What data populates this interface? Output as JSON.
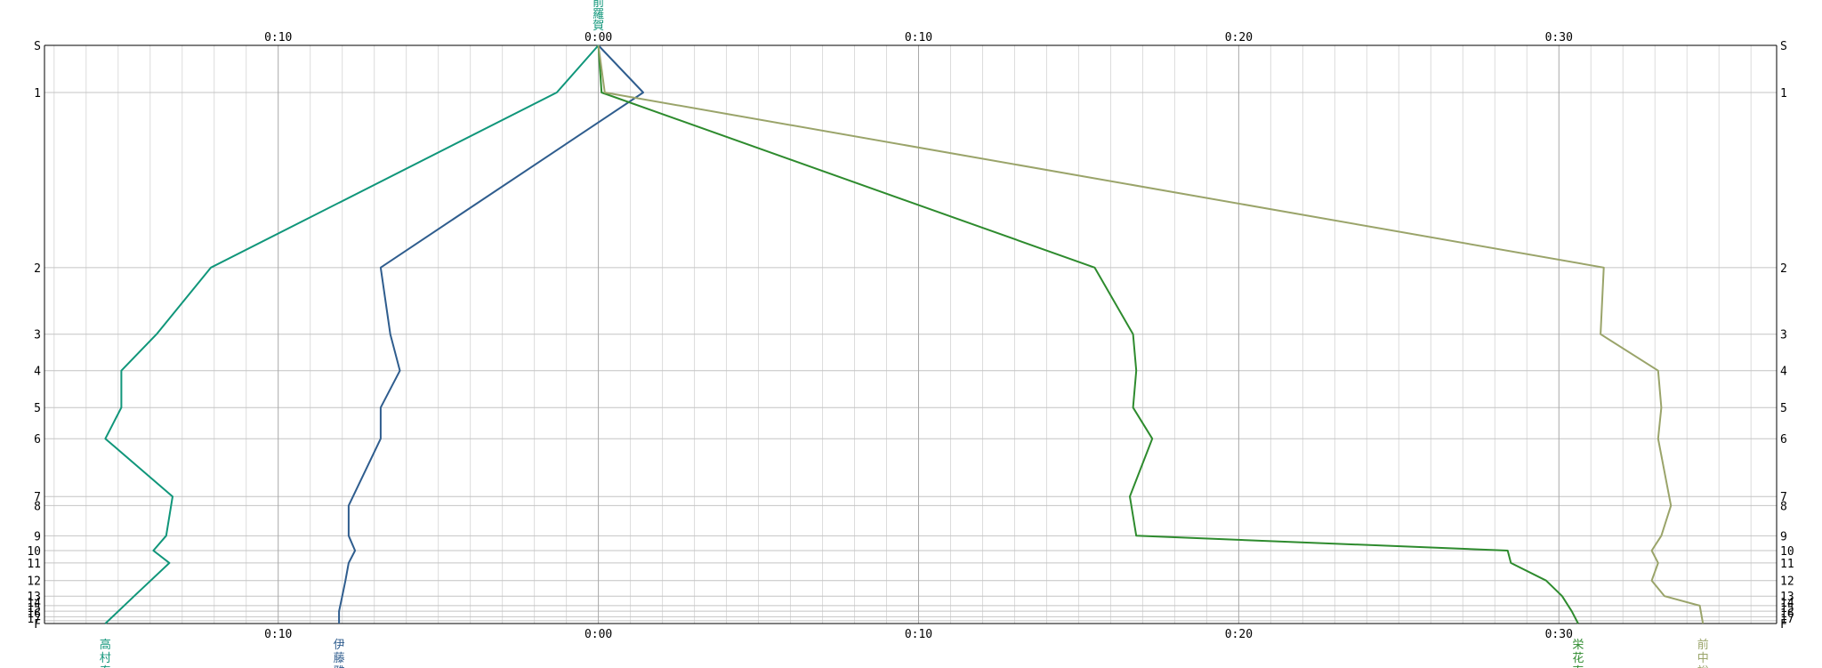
{
  "chart_data": {
    "type": "line",
    "x_unit": "minutes",
    "x_zero_origin": "0:00",
    "x_ticks": [
      {
        "value": -10,
        "label": "0:10"
      },
      {
        "value": 0,
        "label": "0:00"
      },
      {
        "value": 10,
        "label": "0:10"
      },
      {
        "value": 20,
        "label": "0:20"
      },
      {
        "value": 30,
        "label": "0:30"
      }
    ],
    "xlim": [
      -17.3,
      36.8
    ],
    "y_axis": {
      "labels": [
        "S",
        "1",
        "2",
        "3",
        "4",
        "5",
        "6",
        "7",
        "8",
        "9",
        "10",
        "11",
        "12",
        "13",
        "14",
        "15",
        "16",
        "17",
        "F"
      ],
      "values": [
        0,
        2.03,
        9.57,
        12.44,
        14.01,
        15.6,
        16.94,
        19.43,
        19.82,
        21.12,
        21.76,
        22.29,
        23.05,
        23.72,
        24.13,
        24.37,
        24.61,
        24.78,
        24.9
      ]
    },
    "origin_label": "前羅賀",
    "grid": true,
    "series": [
      {
        "name": "高村泰",
        "color": "#10967a",
        "label_lines": [
          "高",
          "村",
          "泰"
        ],
        "x": [
          0.0,
          -1.3,
          -12.1,
          -13.8,
          -14.9,
          -14.9,
          -15.4,
          -13.3,
          -13.5,
          -13.9,
          -13.4,
          -14.5,
          -15.4
        ],
        "y": [
          0,
          2.03,
          9.57,
          12.44,
          14.01,
          15.6,
          16.94,
          19.43,
          21.12,
          21.76,
          22.29,
          23.72,
          24.9
        ]
      },
      {
        "name": "伊藤雅",
        "color": "#2f5d8e",
        "label_lines": [
          "伊",
          "藤",
          "雅"
        ],
        "x": [
          0.0,
          1.4,
          -6.8,
          -6.5,
          -6.2,
          -6.8,
          -6.8,
          -7.8,
          -7.8,
          -7.6,
          -7.8,
          -7.9,
          -8.0,
          -8.1,
          -8.1
        ],
        "y": [
          0,
          2.03,
          9.57,
          12.44,
          14.01,
          15.6,
          16.94,
          19.82,
          21.12,
          21.76,
          22.29,
          23.05,
          23.72,
          24.37,
          24.9
        ]
      },
      {
        "name": "栄花直",
        "color": "#2e8b2e",
        "label_lines": [
          "栄",
          "花",
          "直"
        ],
        "x": [
          0.0,
          0.1,
          15.5,
          16.7,
          16.8,
          16.7,
          17.3,
          16.6,
          16.8,
          28.4,
          28.5,
          29.6,
          30.1,
          30.4,
          30.6
        ],
        "y": [
          0,
          2.03,
          9.57,
          12.44,
          14.01,
          15.6,
          16.94,
          19.43,
          21.12,
          21.76,
          22.29,
          23.05,
          23.72,
          24.37,
          24.9
        ]
      },
      {
        "name": "前中裕",
        "color": "#9aa46a",
        "label_lines": [
          "前",
          "中",
          "裕"
        ],
        "x": [
          0.0,
          0.2,
          31.4,
          31.3,
          33.1,
          33.2,
          33.1,
          33.5,
          33.2,
          32.9,
          33.1,
          32.9,
          33.3,
          34.4,
          34.5
        ],
        "y": [
          0,
          2.03,
          9.57,
          12.44,
          14.01,
          15.6,
          16.94,
          19.82,
          21.12,
          21.76,
          22.29,
          23.05,
          23.72,
          24.13,
          24.9
        ]
      }
    ]
  }
}
